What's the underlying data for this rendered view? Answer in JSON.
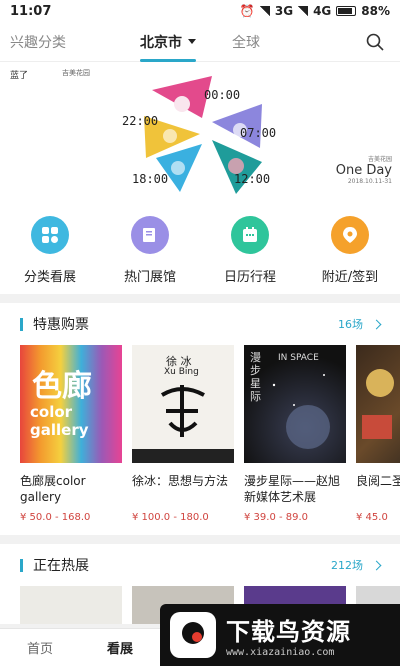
{
  "status": {
    "time": "11:07",
    "net1": "3G",
    "net2": "4G",
    "battery": "88%"
  },
  "nav": {
    "left": "兴趣分类",
    "center": "北京市",
    "right": "全球"
  },
  "banner": {
    "logo": "蓝了",
    "logo2": "吉美花园",
    "times": [
      "22:00",
      "00:00",
      "07:00",
      "18:00",
      "12:00"
    ],
    "side_title": "One Day",
    "side_sub": "吉美花园",
    "side_date": "2018.10.11-31"
  },
  "quick": [
    {
      "label": "分类看展",
      "color": "#3fb8e0",
      "icon": "category-icon"
    },
    {
      "label": "热门展馆",
      "color": "#9a8fe6",
      "icon": "gallery-icon"
    },
    {
      "label": "日历行程",
      "color": "#2fc59b",
      "icon": "calendar-icon"
    },
    {
      "label": "附近/签到",
      "color": "#f5a12b",
      "icon": "location-icon"
    }
  ],
  "section1": {
    "title": "特惠购票",
    "more": "16场",
    "cards": [
      {
        "title": "色廊展color gallery",
        "price": "¥ 50.0 - 168.0",
        "poster_text": "色廊",
        "poster_sub": "color gallery"
      },
      {
        "title": "徐冰：思想与方法",
        "price": "¥ 100.0 - 180.0",
        "poster_text": "徐 冰",
        "poster_sub": "Xu Bing"
      },
      {
        "title": "漫步星际——赵旭新媒体艺术展",
        "price": "¥ 39.0 - 89.0",
        "poster_text": "漫步星际",
        "poster_sub": "IN SPACE"
      },
      {
        "title": "良阅二圣节动",
        "price": "¥ 45.0",
        "poster_text": "",
        "poster_sub": ""
      }
    ]
  },
  "section2": {
    "title": "正在热展",
    "more": "212场"
  },
  "bottom": {
    "home": "首页",
    "exhibit": "看展"
  },
  "watermark": {
    "title": "下载鸟资源",
    "url": "www.xiazainiao.com"
  }
}
